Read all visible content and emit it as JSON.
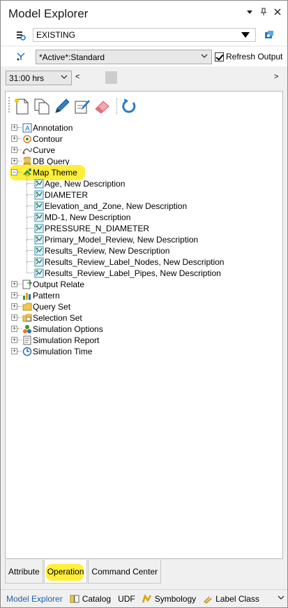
{
  "window": {
    "title": "Model Explorer",
    "ctrl_dropdown": "▾",
    "ctrl_pin": "▯",
    "ctrl_close": "✕"
  },
  "scenario": {
    "value": "EXISTING"
  },
  "filter": {
    "value": "*Active*:Standard",
    "refresh_label": "Refresh Output",
    "refresh_checked": true
  },
  "time": {
    "value": "31:00 hrs",
    "left_arrow": "<",
    "right_arrow": ">"
  },
  "tree": {
    "nodes": [
      {
        "label": "Annotation",
        "icon": "annotation-icon"
      },
      {
        "label": "Contour",
        "icon": "contour-icon"
      },
      {
        "label": "Curve",
        "icon": "curve-icon"
      },
      {
        "label": "DB Query",
        "icon": "db-query-icon"
      },
      {
        "label": "Map Theme",
        "icon": "map-theme-icon",
        "expanded": true,
        "children": [
          "Age, New Description",
          "DIAMETER",
          "Elevation_and_Zone, New Description",
          "MD-1, New Description",
          "PRESSURE_N_DIAMETER",
          "Primary_Model_Review, New Description",
          "Results_Review, New Description",
          "Results_Review_Label_Nodes, New Description",
          "Results_Review_Label_Pipes, New Description"
        ]
      },
      {
        "label": "Output Relate",
        "icon": "output-relate-icon"
      },
      {
        "label": "Pattern",
        "icon": "pattern-icon"
      },
      {
        "label": "Query Set",
        "icon": "query-set-icon"
      },
      {
        "label": "Selection Set",
        "icon": "selection-set-icon"
      },
      {
        "label": "Simulation Options",
        "icon": "simulation-options-icon"
      },
      {
        "label": "Simulation Report",
        "icon": "simulation-report-icon"
      },
      {
        "label": "Simulation Time",
        "icon": "simulation-time-icon"
      }
    ]
  },
  "tabs": [
    {
      "label": "Attribute",
      "active": false
    },
    {
      "label": "Operation",
      "active": true
    },
    {
      "label": "Command Center",
      "active": false
    }
  ],
  "bottom": [
    {
      "label": "Model Explorer",
      "icon": "",
      "active": true
    },
    {
      "label": "Catalog",
      "icon": "catalog-icon"
    },
    {
      "label": "UDF",
      "icon": ""
    },
    {
      "label": "Symbology",
      "icon": "symbology-icon"
    },
    {
      "label": "Label Class",
      "icon": "label-class-icon"
    }
  ],
  "colors": {
    "highlight": "#ffef3a",
    "active_tab_text": "#1e5fa8"
  }
}
